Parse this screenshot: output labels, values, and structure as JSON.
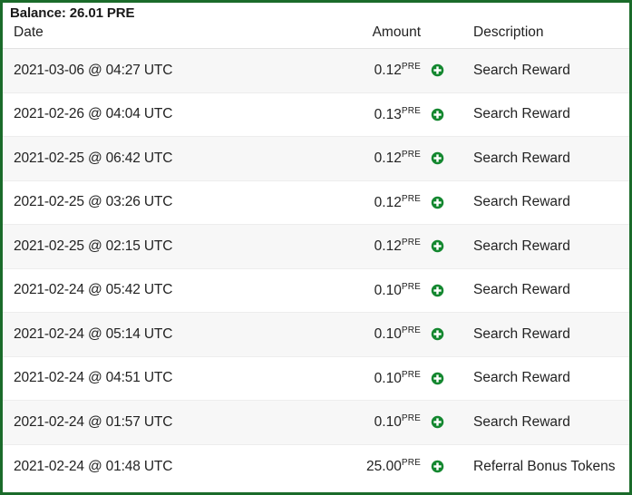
{
  "balance": {
    "label": "Balance: 26.01 PRE"
  },
  "table": {
    "headers": {
      "date": "Date",
      "amount": "Amount",
      "icon": "",
      "description": "Description"
    },
    "rows": [
      {
        "date": "2021-03-06 @ 04:27 UTC",
        "amount": "0.12",
        "unit": "PRE",
        "icon": "plus-circle-icon",
        "description": "Search Reward"
      },
      {
        "date": "2021-02-26 @ 04:04 UTC",
        "amount": "0.13",
        "unit": "PRE",
        "icon": "plus-circle-icon",
        "description": "Search Reward"
      },
      {
        "date": "2021-02-25 @ 06:42 UTC",
        "amount": "0.12",
        "unit": "PRE",
        "icon": "plus-circle-icon",
        "description": "Search Reward"
      },
      {
        "date": "2021-02-25 @ 03:26 UTC",
        "amount": "0.12",
        "unit": "PRE",
        "icon": "plus-circle-icon",
        "description": "Search Reward"
      },
      {
        "date": "2021-02-25 @ 02:15 UTC",
        "amount": "0.12",
        "unit": "PRE",
        "icon": "plus-circle-icon",
        "description": "Search Reward"
      },
      {
        "date": "2021-02-24 @ 05:42 UTC",
        "amount": "0.10",
        "unit": "PRE",
        "icon": "plus-circle-icon",
        "description": "Search Reward"
      },
      {
        "date": "2021-02-24 @ 05:14 UTC",
        "amount": "0.10",
        "unit": "PRE",
        "icon": "plus-circle-icon",
        "description": "Search Reward"
      },
      {
        "date": "2021-02-24 @ 04:51 UTC",
        "amount": "0.10",
        "unit": "PRE",
        "icon": "plus-circle-icon",
        "description": "Search Reward"
      },
      {
        "date": "2021-02-24 @ 01:57 UTC",
        "amount": "0.10",
        "unit": "PRE",
        "icon": "plus-circle-icon",
        "description": "Search Reward"
      },
      {
        "date": "2021-02-24 @ 01:48 UTC",
        "amount": "25.00",
        "unit": "PRE",
        "icon": "plus-circle-icon",
        "description": "Referral Bonus Tokens"
      }
    ]
  },
  "colors": {
    "border": "#1a6b2a",
    "credit_icon": "#13872f",
    "row_stripe": "#f7f7f7",
    "row_divider": "#ededed",
    "text": "#222222"
  }
}
